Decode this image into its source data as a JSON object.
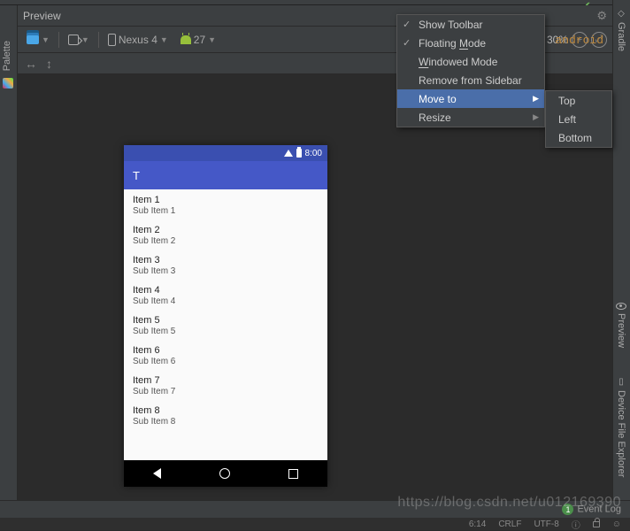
{
  "header": {
    "title": "Preview"
  },
  "toolbar": {
    "device": "Nexus 4",
    "api": "27",
    "zoom": "30%"
  },
  "context_menu": {
    "show_toolbar": "Show Toolbar",
    "floating": "Floating Mode",
    "floating_ul": "M",
    "windowed": "Windowed Mode",
    "windowed_ul": "W",
    "remove": "Remove from Sidebar",
    "move_to": "Move to",
    "resize": "Resize"
  },
  "sub_menu": {
    "top": "Top",
    "left": "Left",
    "bottom": "Bottom"
  },
  "phone": {
    "time": "8:00",
    "app_title": "T",
    "items": [
      {
        "title": "Item 1",
        "sub": "Sub Item 1"
      },
      {
        "title": "Item 2",
        "sub": "Sub Item 2"
      },
      {
        "title": "Item 3",
        "sub": "Sub Item 3"
      },
      {
        "title": "Item 4",
        "sub": "Sub Item 4"
      },
      {
        "title": "Item 5",
        "sub": "Sub Item 5"
      },
      {
        "title": "Item 6",
        "sub": "Sub Item 6"
      },
      {
        "title": "Item 7",
        "sub": "Sub Item 7"
      },
      {
        "title": "Item 8",
        "sub": "Sub Item 8"
      }
    ]
  },
  "side_tabs": {
    "gradle": "Gradle",
    "palette": "Palette",
    "preview": "Preview",
    "device": "Device File Explorer"
  },
  "bg": {
    "android": "android",
    "preview_stub": "preview"
  },
  "status": {
    "event_log": "Event Log",
    "event_count": "1",
    "pos": "6:14",
    "crlf": "CRLF",
    "enc": "UTF-8"
  },
  "watermark": "https://blog.csdn.net/u012169390"
}
